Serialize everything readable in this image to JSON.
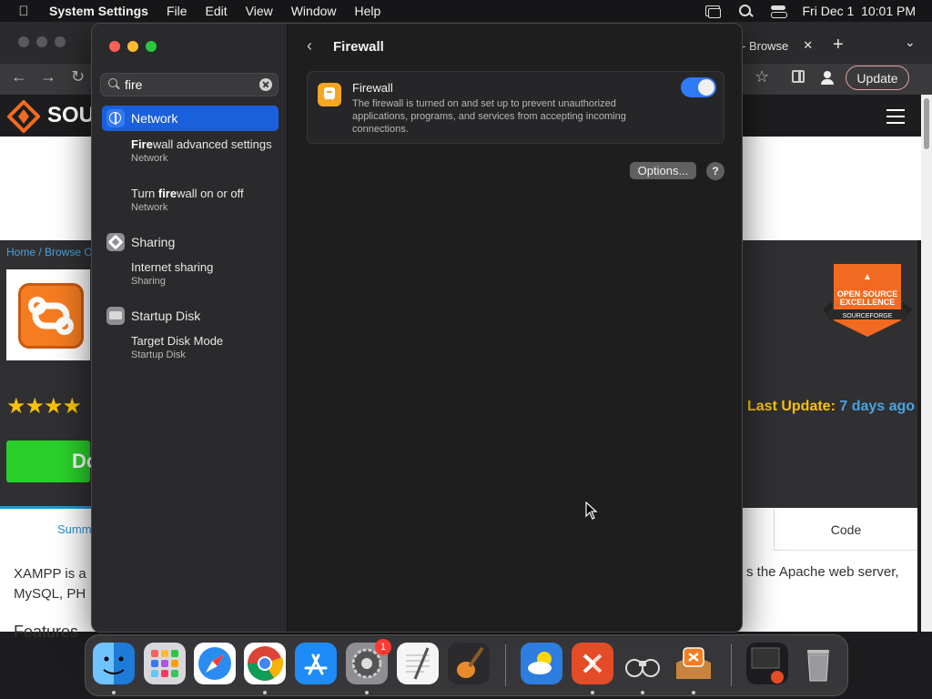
{
  "menubar": {
    "app_name": "System Settings",
    "menus": [
      "File",
      "Edit",
      "View",
      "Window",
      "Help"
    ],
    "datetime": "Fri Dec 1  10:01 PM"
  },
  "browser": {
    "tab_label": "- Browse",
    "update_label": "Update",
    "site_name": "SOU",
    "breadcrumb": "Home / Browse O",
    "download_label": "Do",
    "last_update_label": "Last Update:",
    "last_update_value": "7 days ago",
    "summary_tab": "Summ",
    "code_tab": "Code",
    "desc_left_1": "XAMPP is a",
    "desc_left_2": "MySQL, PH",
    "desc_right": "s the Apache web server,",
    "features": "Features",
    "badge_line1": "OPEN SOURCE",
    "badge_line2": "EXCELLENCE",
    "badge_line3": "SOURCEFORGE"
  },
  "sidebar": {
    "search_value": "fire",
    "categories": [
      {
        "label": "Network",
        "icon": "globe-icon",
        "results": [
          {
            "title_pre": "",
            "title_match": "Fire",
            "title_post": "wall advanced settings",
            "category": "Network"
          },
          {
            "title_pre": "Turn ",
            "title_match": "fire",
            "title_post": "wall on or off",
            "category": "Network"
          }
        ]
      },
      {
        "label": "Sharing",
        "icon": "sharing-icon",
        "results": [
          {
            "title": "Internet sharing",
            "category": "Sharing"
          }
        ]
      },
      {
        "label": "Startup Disk",
        "icon": "disk-icon",
        "results": [
          {
            "title": "Target Disk Mode",
            "category": "Startup Disk"
          }
        ]
      }
    ]
  },
  "detail": {
    "title": "Firewall",
    "firewall_name": "Firewall",
    "firewall_desc": "The firewall is turned on and set up to prevent unauthorized applications, programs, and services from accepting incoming connections.",
    "firewall_enabled": true,
    "options_label": "Options...",
    "help_label": "?"
  },
  "dock": {
    "apps": [
      "Finder",
      "Launchpad",
      "Safari",
      "Chrome",
      "App Store",
      "System Settings",
      "TextEdit",
      "GarageBand",
      "Weather",
      "Remote Desktop",
      "Preview",
      "XAMPP",
      "Downloads",
      "Trash"
    ],
    "settings_badge": "1"
  },
  "colors": {
    "accent": "#1a5fdb",
    "toggle_on": "#2f7bf5",
    "firewall_icon": "#f5a623"
  }
}
